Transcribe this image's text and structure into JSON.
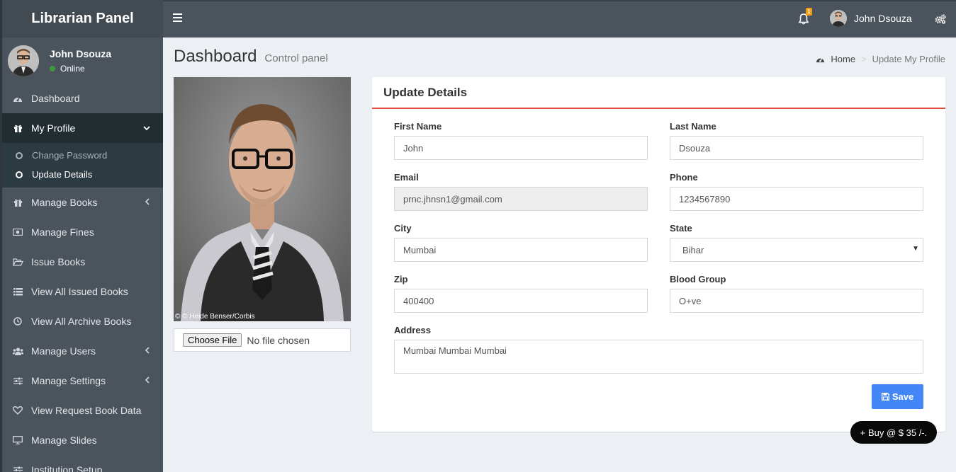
{
  "brand": "Librarian Panel",
  "user": {
    "name": "John Dsouza",
    "status": "Online"
  },
  "sidebar": {
    "items": [
      {
        "label": "Dashboard",
        "icon": "dashboard-icon"
      },
      {
        "label": "My Profile",
        "icon": "gift-icon",
        "expanded": true,
        "children": [
          "Change Password",
          "Update Details"
        ]
      },
      {
        "label": "Manage Books",
        "icon": "gift-icon",
        "has_children": true
      },
      {
        "label": "Manage Fines",
        "icon": "money-icon"
      },
      {
        "label": "Issue Books",
        "icon": "folder-open-icon"
      },
      {
        "label": "View All Issued Books",
        "icon": "list-icon"
      },
      {
        "label": "View All Archive Books",
        "icon": "clock-icon"
      },
      {
        "label": "Manage Users",
        "icon": "users-icon",
        "has_children": true
      },
      {
        "label": "Manage Settings",
        "icon": "sliders-icon",
        "has_children": true
      },
      {
        "label": "View Request Book Data",
        "icon": "heart-icon"
      },
      {
        "label": "Manage Slides",
        "icon": "desktop-icon"
      },
      {
        "label": "Institution Setup",
        "icon": "sliders-icon"
      }
    ]
  },
  "topbar": {
    "notification_count": "1"
  },
  "header": {
    "title": "Dashboard",
    "subtitle": "Control panel"
  },
  "breadcrumb": {
    "home": "Home",
    "current": "Update My Profile"
  },
  "photo": {
    "credit": "© © Heide Benser/Corbis"
  },
  "file_input": {
    "button": "Choose File",
    "status": "No file chosen"
  },
  "form": {
    "title": "Update Details",
    "first_name": {
      "label": "First Name",
      "value": "John"
    },
    "last_name": {
      "label": "Last Name",
      "value": "Dsouza"
    },
    "email": {
      "label": "Email",
      "value": "prnc.jhnsn1@gmail.com"
    },
    "phone": {
      "label": "Phone",
      "value": "1234567890"
    },
    "city": {
      "label": "City",
      "value": "Mumbai"
    },
    "state": {
      "label": "State",
      "value": "Bihar"
    },
    "zip": {
      "label": "Zip",
      "value": "400400"
    },
    "blood_group": {
      "label": "Blood Group",
      "value": "O+ve"
    },
    "address": {
      "label": "Address",
      "value": "Mumbai Mumbai Mumbai"
    },
    "save_label": "Save"
  },
  "buy_label": "+ Buy @ $ 35 /-.",
  "colors": {
    "sidebar": "#4b545c",
    "accent_red": "#dd4b39",
    "save_blue": "#4287f5",
    "online": "#3c9a3c"
  }
}
